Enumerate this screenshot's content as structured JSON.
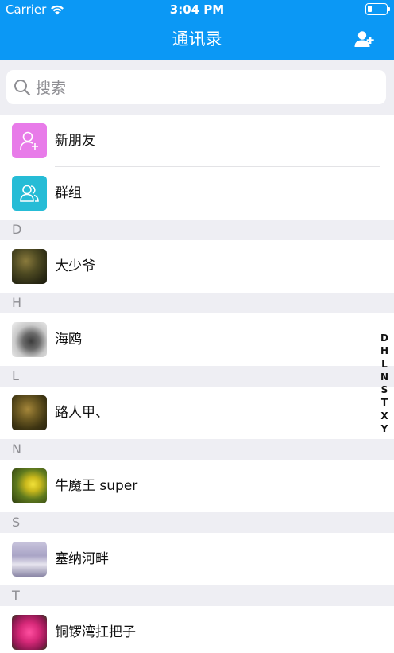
{
  "status_bar": {
    "carrier": "Carrier",
    "time": "3:04 PM"
  },
  "nav": {
    "title": "通讯录"
  },
  "search": {
    "placeholder": "搜索"
  },
  "functions": [
    {
      "label": "新朋友",
      "icon": "add-friend-icon",
      "color": "#e87be9"
    },
    {
      "label": "群组",
      "icon": "group-icon",
      "color": "#26bcd6"
    }
  ],
  "sections": [
    {
      "letter": "D",
      "contacts": [
        {
          "name": "大少爷"
        }
      ]
    },
    {
      "letter": "H",
      "contacts": [
        {
          "name": "海鸥"
        }
      ]
    },
    {
      "letter": "L",
      "contacts": [
        {
          "name": "路人甲、"
        }
      ]
    },
    {
      "letter": "N",
      "contacts": [
        {
          "name": "牛魔王 super"
        }
      ]
    },
    {
      "letter": "S",
      "contacts": [
        {
          "name": "塞纳河畔"
        }
      ]
    },
    {
      "letter": "T",
      "contacts": [
        {
          "name": "铜锣湾扛把子"
        }
      ]
    }
  ],
  "index_letters": [
    "D",
    "H",
    "L",
    "N",
    "S",
    "T",
    "X",
    "Y"
  ],
  "colors": {
    "nav_background": "#0b98f5",
    "section_background": "#eeeef3"
  }
}
